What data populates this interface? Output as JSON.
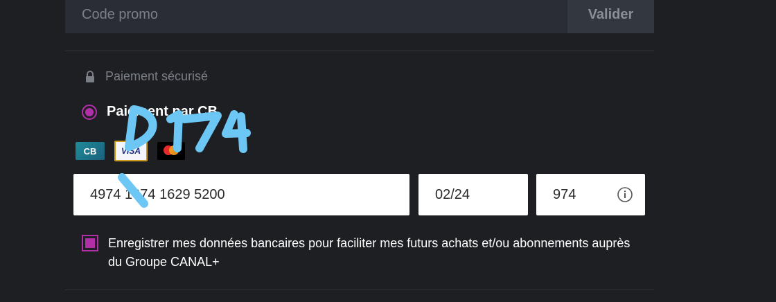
{
  "promo": {
    "placeholder": "Code promo",
    "button_label": "Valider"
  },
  "payment": {
    "secure_label": "Paiement sécurisé",
    "method_label": "Paiement par CB",
    "cards": [
      {
        "name": "CB",
        "label": "CB"
      },
      {
        "name": "VISA",
        "label": "VISA"
      },
      {
        "name": "mastercard",
        "label": "mastercard"
      }
    ],
    "card_number": "4974 1074 1629 5200",
    "expiry": "02/24",
    "cvv": "974",
    "save_label": "Enregistrer mes données bancaires pour faciliter mes futurs achats et/ou abonnements auprès du Groupe CANAL+",
    "annotation": "D174"
  },
  "colors": {
    "accent": "#b32fa8",
    "background": "#1e1f23",
    "scribble": "#6cc7f5"
  }
}
